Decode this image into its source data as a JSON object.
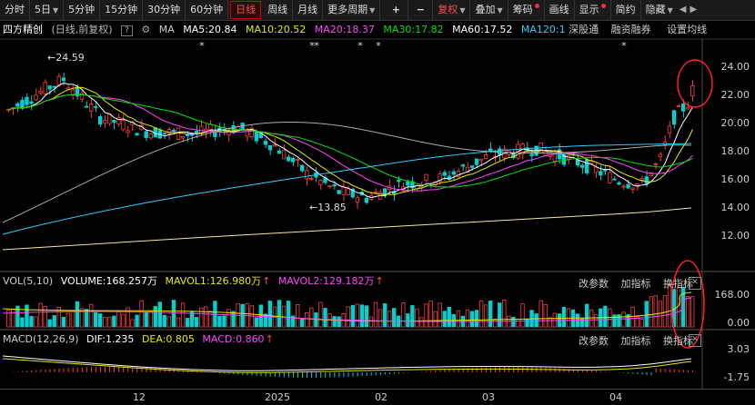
{
  "toolbar": {
    "items": [
      "分时",
      "5日",
      "5分钟",
      "15分钟",
      "30分钟",
      "60分钟",
      "日线",
      "周线",
      "月线",
      "更多周期"
    ],
    "active_index": 6,
    "plus": "+",
    "minus": "−",
    "fuquan": "复权",
    "overlay": "叠加",
    "chip": "筹码",
    "draw": "画线",
    "display": "显示",
    "simplified": "简约",
    "hide": "隐藏"
  },
  "info": {
    "stock_name": "四方精创",
    "period_note": "(日线,前复权)",
    "help": "?",
    "ma_label": "MA",
    "ma5": "MA5:20.84",
    "ma10": "MA10:20.52",
    "ma20": "MA20:18.37",
    "ma30": "MA30:17.82",
    "ma60": "MA60:17.52",
    "ma120": "MA120:1",
    "tag1": "深股通",
    "tag2": "融资融券",
    "settings": "设置均线"
  },
  "price_axis": [
    "24.00",
    "22.00",
    "20.00",
    "18.00",
    "16.00",
    "14.00",
    "12.00"
  ],
  "annotations": {
    "high": "24.59",
    "low": "13.85"
  },
  "vol": {
    "title": "VOL(5,10)",
    "volume": "VOLUME:168.257万",
    "mavol1": "MAVOL1:126.980万",
    "mavol2": "MAVOL2:129.182万",
    "axis": [
      "168.00",
      "0.00"
    ],
    "btn_params": "改参数",
    "btn_add": "加指标",
    "btn_switch": "换指标"
  },
  "macd": {
    "title": "MACD(12,26,9)",
    "dif": "DIF:1.235",
    "dea": "DEA:0.805",
    "macd": "MACD:0.860",
    "axis": [
      "3.03",
      "-1.75"
    ],
    "btn_params": "改参数",
    "btn_add": "加指标",
    "btn_switch": "换指标"
  },
  "time_axis": [
    "12",
    "2025",
    "02",
    "03",
    "04"
  ],
  "colors": {
    "up": "#ff3b3b",
    "down": "#00d0d0",
    "ma5": "#ffffff",
    "ma10": "#e8e800",
    "ma20": "#ff44ff",
    "ma30": "#00e000",
    "ma60": "#aaaaaa",
    "ma120": "#33ccff",
    "ma250": "#f5e6a0",
    "circle": "#ff2020"
  }
}
